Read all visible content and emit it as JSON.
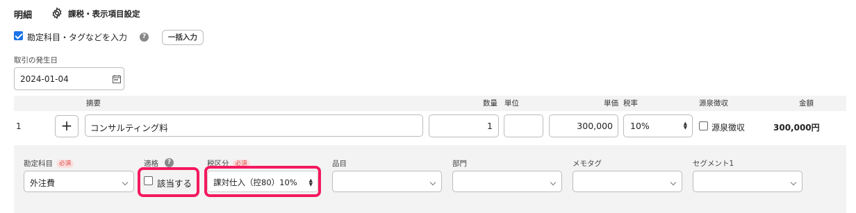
{
  "header": {
    "title": "明細",
    "settings_label": "課税・表示項目設定"
  },
  "options": {
    "input_account_label": "勘定科目・タグなどを入力",
    "input_account_checked": true,
    "bulk_input_label": "一括入力"
  },
  "transaction": {
    "date_label": "取引の発生日",
    "date_value": "2024-01-04"
  },
  "table": {
    "columns": {
      "summary": "摘要",
      "quantity": "数量",
      "unit": "単位",
      "unit_price": "単価",
      "tax_rate": "税率",
      "withholding": "源泉徴収",
      "amount": "金額"
    },
    "rows": [
      {
        "index": "1",
        "summary": "コンサルティング料",
        "quantity": "1",
        "unit": "",
        "unit_price": "300,000",
        "tax_rate": "10%",
        "withholding_label": "源泉徴収",
        "withholding_checked": false,
        "amount": "300,000円"
      }
    ]
  },
  "detail": {
    "account_label": "勘定科目",
    "required_badge": "必須",
    "account_value": "外注費",
    "qualified_label": "適格",
    "qualified_checkbox_label": "該当する",
    "qualified_checked": false,
    "tax_category_label": "税区分",
    "tax_category_value": "課対仕入（控80）10%",
    "item_label": "品目",
    "department_label": "部門",
    "memo_tag_label": "メモタグ",
    "segment_label": "セグメント1"
  },
  "colors": {
    "highlight": "#f4195f",
    "checkbox_checked": "#1a73e8",
    "required_badge_bg": "#fbe0e0",
    "required_badge_text": "#e04848",
    "panel_bg": "#f3f3f3"
  }
}
